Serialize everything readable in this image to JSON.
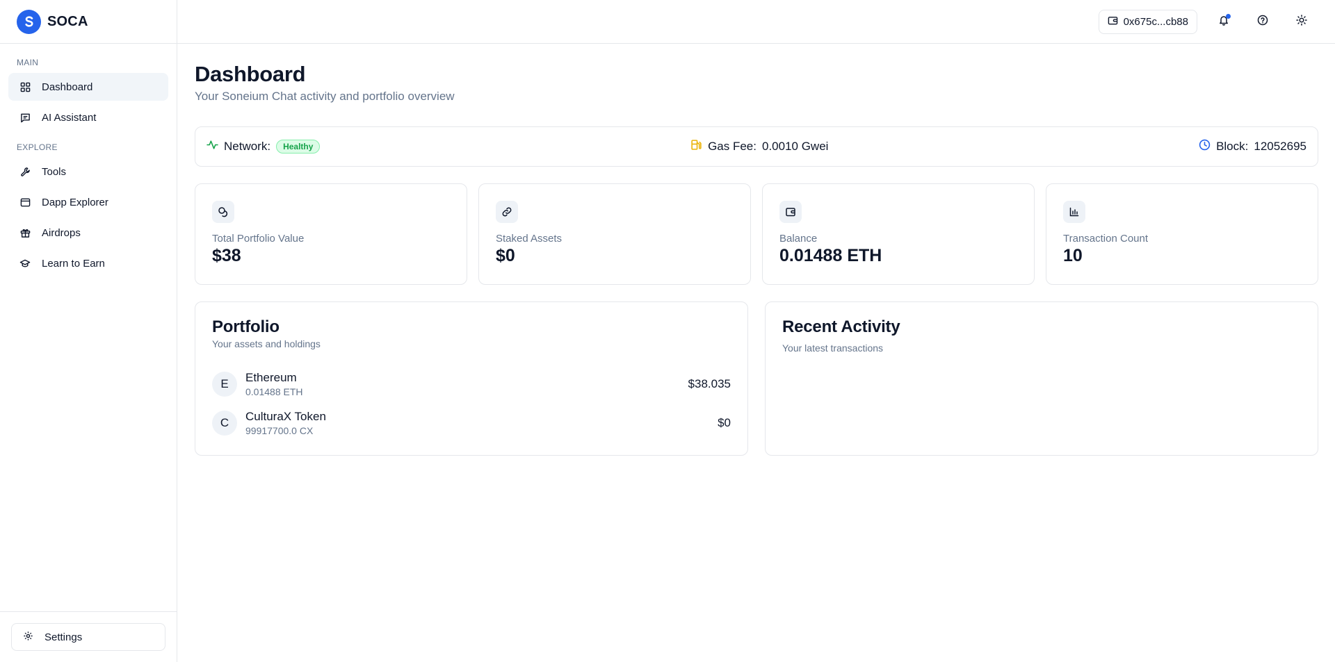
{
  "brand": {
    "name": "SOCA",
    "logo_letter": "S",
    "accent": "#2563eb"
  },
  "sidebar": {
    "sections": [
      {
        "title": "MAIN",
        "items": [
          {
            "label": "Dashboard",
            "icon": "grid-icon",
            "active": true
          },
          {
            "label": "AI Assistant",
            "icon": "message-square-icon",
            "active": false
          }
        ]
      },
      {
        "title": "EXPLORE",
        "items": [
          {
            "label": "Tools",
            "icon": "wrench-icon",
            "active": false
          },
          {
            "label": "Dapp Explorer",
            "icon": "browser-window-icon",
            "active": false
          },
          {
            "label": "Airdrops",
            "icon": "gift-icon",
            "active": false
          },
          {
            "label": "Learn to Earn",
            "icon": "graduation-cap-icon",
            "active": false
          }
        ]
      }
    ],
    "footer": {
      "settings_label": "Settings",
      "icon": "gear-icon"
    }
  },
  "topbar": {
    "wallet_address": "0x675c...cb88",
    "icons": [
      "wallet-icon",
      "bell-icon",
      "help-circle-icon",
      "sun-icon"
    ],
    "notification_dot_color": "#2563eb"
  },
  "page": {
    "title": "Dashboard",
    "subtitle": "Your Soneium Chat activity and portfolio overview"
  },
  "network": {
    "label": "Network:",
    "status": "Healthy",
    "status_color": "#16a34a",
    "gas_label": "Gas Fee:",
    "gas_value": "0.0010 Gwei",
    "gas_icon_color": "#eab308",
    "block_label": "Block:",
    "block_value": "12052695",
    "block_icon_color": "#2563eb"
  },
  "stats": [
    {
      "label": "Total Portfolio Value",
      "value": "$38",
      "icon": "coins-icon"
    },
    {
      "label": "Staked Assets",
      "value": "$0",
      "icon": "link-icon"
    },
    {
      "label": "Balance",
      "value": "0.01488 ETH",
      "icon": "wallet-icon"
    },
    {
      "label": "Transaction Count",
      "value": "10",
      "icon": "bar-chart-icon"
    }
  ],
  "portfolio": {
    "title": "Portfolio",
    "subtitle": "Your assets and holdings",
    "assets": [
      {
        "initial": "E",
        "name": "Ethereum",
        "amount": "0.01488 ETH",
        "value": "$38.035"
      },
      {
        "initial": "C",
        "name": "CulturaX Token",
        "amount": "99917700.0 CX",
        "value": "$0"
      }
    ]
  },
  "activity": {
    "title": "Recent Activity",
    "subtitle": "Your latest transactions"
  }
}
